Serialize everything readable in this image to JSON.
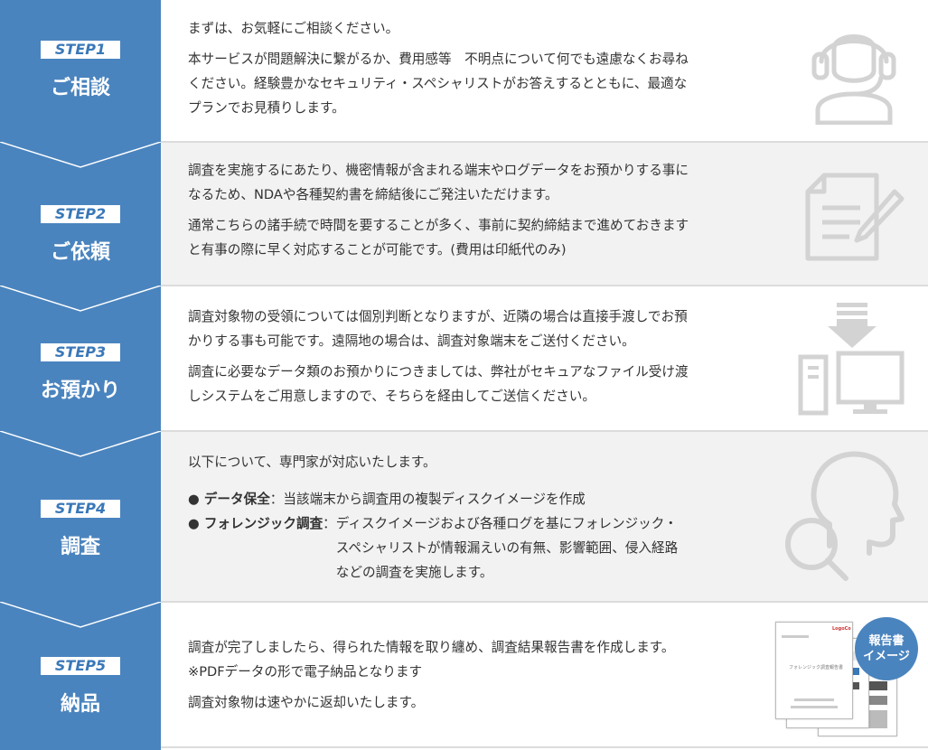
{
  "colors": {
    "accent": "#4a84be",
    "badge_text": "#3a78b8",
    "icon_gray": "#d0d0d0"
  },
  "steps": [
    {
      "badge": "STEP1",
      "title": "ご相談",
      "icon": "headset-person-icon",
      "paragraphs": [
        [
          "まずは、お気軽にご相談ください。"
        ],
        [
          "本サービスが問題解決に繋がるか、費用感等　不明点について何でも遠慮なくお尋ね",
          "ください。経験豊かなセキュリティ・スペシャリストがお答えするとともに、最適な",
          "プランでお見積りします。"
        ]
      ]
    },
    {
      "badge": "STEP2",
      "title": "ご依頼",
      "icon": "document-pen-icon",
      "paragraphs": [
        [
          "調査を実施するにあたり、機密情報が含まれる端末やログデータをお預かりする事に",
          "なるため、NDAや各種契約書を締結後にご発注いただけます。"
        ],
        [
          "通常こちらの諸手続で時間を要することが多く、事前に契約締結まで進めておきます",
          "と有事の際に早く対応することが可能です。(費用は印紙代のみ)"
        ]
      ]
    },
    {
      "badge": "STEP3",
      "title": "お預かり",
      "icon": "computer-download-icon",
      "paragraphs": [
        [
          "調査対象物の受領については個別判断となりますが、近隣の場合は直接手渡しでお預",
          "かりする事も可能です。遠隔地の場合は、調査対象端末をご送付ください。"
        ],
        [
          "調査に必要なデータ類のお預かりにつきましては、弊社がセキュアなファイル受け渡",
          "しシステムをご用意しますので、そちらを経由してご送信ください。"
        ]
      ]
    },
    {
      "badge": "STEP4",
      "title": "調査",
      "icon": "head-magnifier-icon",
      "intro": "以下について、専門家が対応いたします。",
      "bullets": [
        {
          "label": "● データ保全",
          "sep": "：",
          "lines": [
            "当該端末から調査用の複製ディスクイメージを作成"
          ]
        },
        {
          "label": "● フォレンジック調査",
          "sep": "：",
          "lines": [
            "ディスクイメージおよび各種ログを基にフォレンジック・",
            "スペシャリストが情報漏えいの有無、影響範囲、侵入経路",
            "などの調査を実施します。"
          ]
        }
      ]
    },
    {
      "badge": "STEP5",
      "title": "納品",
      "icon": "report-document-icon",
      "paragraphs": [
        [
          "調査が完了しましたら、得られた情報を取り纏め、調査結果報告書を作成します。",
          "※PDFデータの形で電子納品となります"
        ],
        [
          "調査対象物は速やかに返却いたします。"
        ]
      ],
      "report_badge": [
        "報告書",
        "イメージ"
      ],
      "doc_title": "フォレンジック調査報告書",
      "doc_brand": "LogoCo"
    }
  ]
}
